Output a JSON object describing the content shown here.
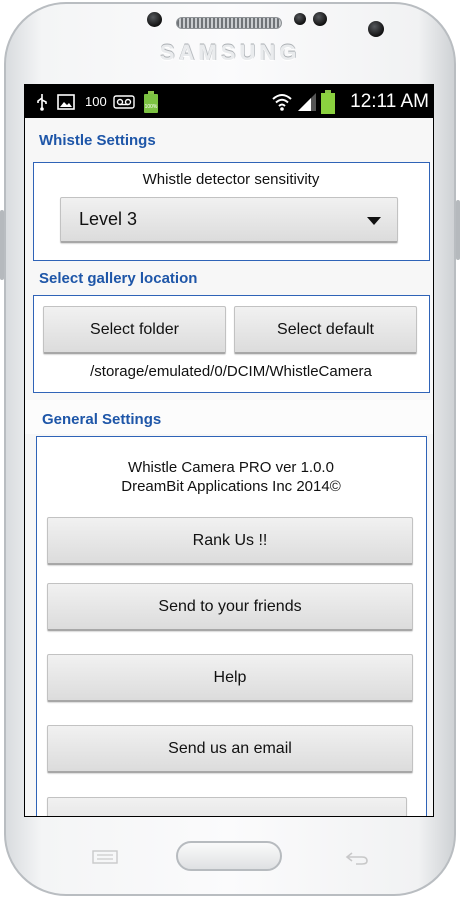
{
  "device": {
    "brand": "SAMSUNG"
  },
  "status_bar": {
    "icons": [
      "usb-icon",
      "image-icon",
      "voicemail-icon",
      "battery-full-icon",
      "wifi-icon",
      "signal-icon",
      "battery-charging-icon"
    ],
    "notification_count": "100",
    "small_battery_label": "100%",
    "time": "12:11 AM"
  },
  "whistle_settings": {
    "title": "Whistle Settings",
    "sensitivity_label": "Whistle detector sensitivity",
    "sensitivity_value": "Level 3"
  },
  "gallery": {
    "title": "Select gallery location",
    "select_folder_label": "Select folder",
    "select_default_label": "Select default",
    "path": "/storage/emulated/0/DCIM/WhistleCamera"
  },
  "general": {
    "title": "General Settings",
    "version": "Whistle Camera PRO ver 1.0.0",
    "company": "DreamBit Applications Inc 2014©",
    "buttons": {
      "rank": "Rank Us !!",
      "send_friends": "Send to your friends",
      "help": "Help",
      "email": "Send us an email"
    }
  },
  "colors": {
    "accent": "#1e56a8",
    "panel_border": "#2f63b7",
    "status_bar": "#000000"
  }
}
